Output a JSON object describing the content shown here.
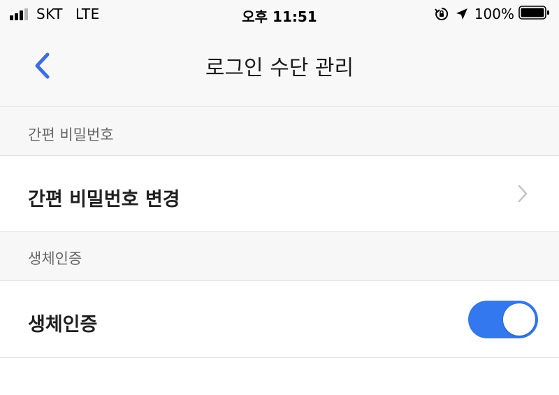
{
  "status_bar": {
    "carrier": "SKT",
    "network": "LTE",
    "time": "오후 11:51",
    "battery_percent": "100%",
    "icons": [
      "signal-icon",
      "orientation-lock-icon",
      "location-arrow-icon",
      "battery-icon"
    ]
  },
  "nav": {
    "title": "로그인 수단 관리",
    "back_icon": "chevron-left-icon"
  },
  "sections": [
    {
      "header": "간편 비밀번호",
      "row_label": "간편 비밀번호 변경",
      "row_icon": "chevron-right-icon"
    },
    {
      "header": "생체인증",
      "row_label": "생체인증",
      "toggle_on": true
    }
  ],
  "colors": {
    "accent": "#3478f0",
    "back_arrow": "#3b6ee0",
    "chevron": "#c4c4c4",
    "section_bg": "#f7f7f7",
    "divider": "#e3e3e3"
  }
}
